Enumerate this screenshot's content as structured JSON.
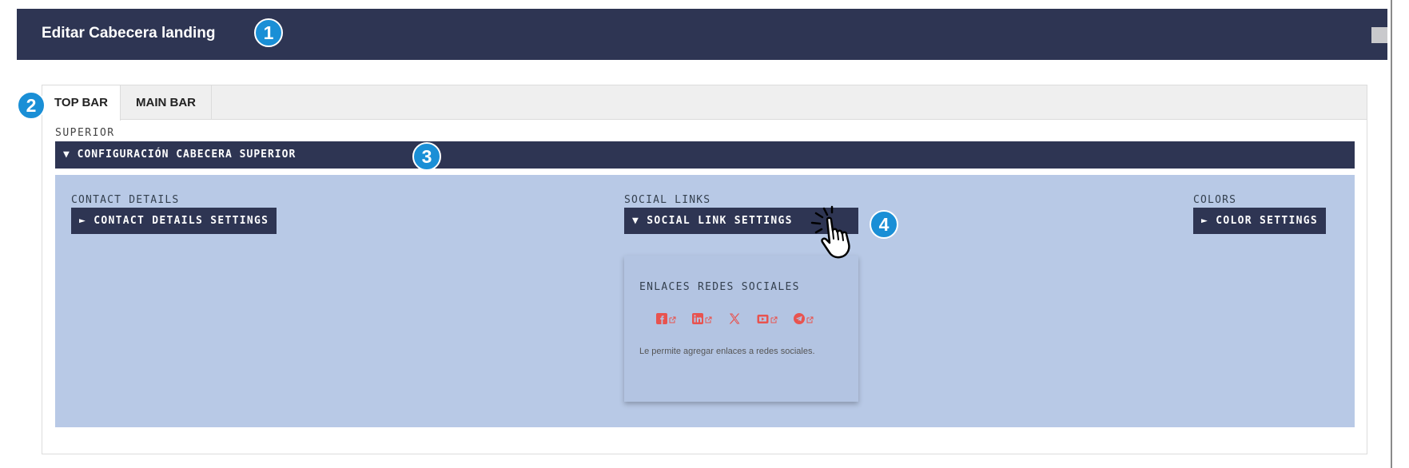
{
  "header": {
    "title": "Editar Cabecera landing"
  },
  "badges": [
    "1",
    "2",
    "3",
    "4"
  ],
  "tabs": [
    {
      "label": "TOP BAR",
      "active": true
    },
    {
      "label": "MAIN BAR",
      "active": false
    }
  ],
  "section_label": "SUPERIOR",
  "config_bar": {
    "label": "▼ CONFIGURACIÓN CABECERA SUPERIOR"
  },
  "columns": {
    "contact": {
      "label": "CONTACT DETAILS",
      "button": "► CONTACT DETAILS SETTINGS"
    },
    "social": {
      "label": "SOCIAL LINKS",
      "button": "▼ SOCIAL LINK SETTINGS"
    },
    "colors": {
      "label": "COLORS",
      "button": "► COLOR SETTINGS"
    }
  },
  "social_popup": {
    "title": "ENLACES REDES SOCIALES",
    "icons": [
      "facebook-icon",
      "linkedin-icon",
      "x-icon",
      "youtube-icon",
      "telegram-icon"
    ],
    "description": "Le permite agregar enlaces a redes sociales."
  },
  "colors": {
    "navy": "#2e3553",
    "panel_blue": "#b8c9e6",
    "badge_blue": "#1a8fd6",
    "social_red": "#e8534f"
  }
}
